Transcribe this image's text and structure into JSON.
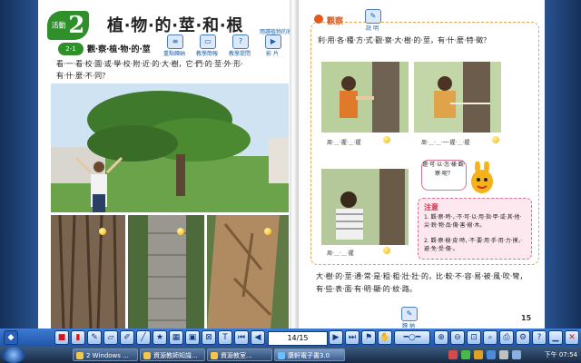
{
  "left_page": {
    "activity_label": "活動",
    "activity_number": "2",
    "title": "植‧物‧的‧莖‧和‧根",
    "reference": "閱讀植物的家 3",
    "section_number": "2-1",
    "section_title": "觀‧察‧植‧物‧的‧莖",
    "tools": [
      {
        "label": "重點歸納",
        "icon": "notes-icon"
      },
      {
        "label": "教學簡報",
        "icon": "slides-icon"
      },
      {
        "label": "教學提問",
        "icon": "question-icon"
      },
      {
        "label": "影 片",
        "icon": "video-icon"
      }
    ],
    "intro_text": "看‧一‧看‧校‧園‧或‧學‧校‧附‧近‧的‧大‧樹，它‧們‧的‧莖‧外‧形‧有‧什‧麼‧不‧同？"
  },
  "right_page": {
    "observe_label": "觀察",
    "explain_label": "說 明",
    "observe_text": "利‧用‧各‧種‧方‧式‧觀‧察‧大‧樹‧的‧莖，有‧什‧麼‧特‧徵？",
    "caption_1": "周‧＿‧握‧＿‧握",
    "caption_2": "周‧＿‧＿‧一‧握‧＿‧握",
    "caption_3": "周‧＿‧＿‧握",
    "bubble_text": "還‧可‧以‧怎‧樣‧觀‧察‧呢？",
    "note_title": "注意",
    "note_items": [
      "1. 觀‧察‧時‧，‧不‧可‧以‧用‧指‧甲‧或‧其‧他‧尖‧銳‧物‧品‧傷‧害‧樹‧木。",
      "2. 觀‧察‧樹‧皮‧時，‧不‧要‧用‧手‧用‧力‧摸，‧避‧免‧受‧傷‧。"
    ],
    "summary_text": "大‧樹‧的‧莖‧通‧常‧是‧粗‧粗‧壯‧壯‧的，比‧較‧不‧容‧易‧被‧風‧吹‧彎，有‧些‧表‧面‧有‧明‧顯‧的‧紋‧路。",
    "summary_label": "歸 納",
    "page_number": "15"
  },
  "toolbar": {
    "page_indicator": "14/15"
  },
  "taskbar": {
    "tasks": [
      "2 Windows ...",
      "資源教師知識...",
      "資源教室...",
      "康軒電子書3.0"
    ],
    "clock": "下午 07:54"
  },
  "colors": {
    "accent_green": "#2f8f2a",
    "accent_orange": "#e05a20",
    "toolbar_blue": "#1f55a8"
  }
}
